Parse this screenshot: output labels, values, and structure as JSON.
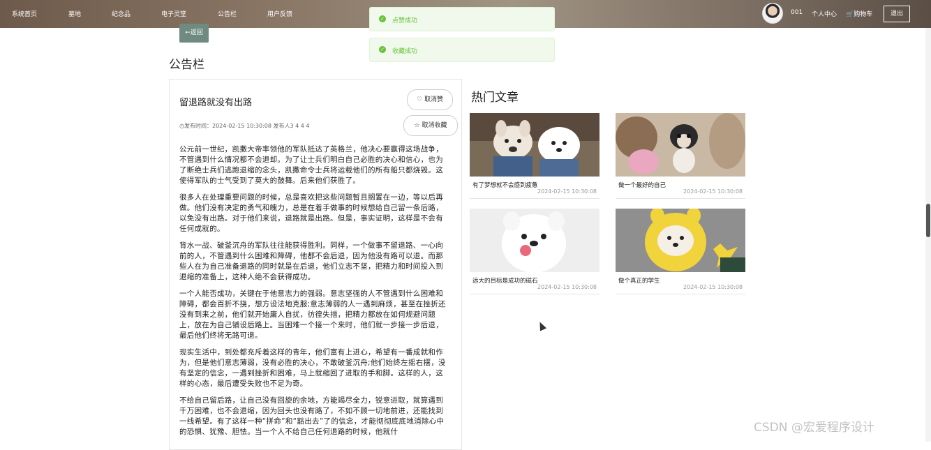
{
  "nav": {
    "items": [
      "系统首页",
      "墓地",
      "纪念品",
      "电子灵堂",
      "公告栏",
      "用户反馈"
    ],
    "user_id": "001",
    "user_center": "个人中心",
    "cart": "购物车",
    "logout": "退出"
  },
  "back_label": "←返回",
  "toasts": [
    "点赞成功",
    "收藏成功"
  ],
  "page_title": "公告栏",
  "article": {
    "title": "留退路就没有出路",
    "unlike_label": "取消赞",
    "unfav_label": "取消收藏",
    "meta": "发布时间：2024-02-15 10:30:08 发布人3 4 4 4",
    "paragraphs": [
      "公元前一世纪，凯撒大帝率领他的军队抵达了英格兰，他决心要赢得这场战争，不管遇到什么情况都不会退却。为了让士兵们明白自己必胜的决心和信心，也为了断绝士兵们逃跑退缩的念头，凯撒命令士兵将运载他们的所有船只都烧毁。这使得军队的士气受到了莫大的鼓舞。后来他们获胜了。",
      "很多人在处理重要问题的时候，总是喜欢把这些问题暂且搁置在一边，等以后再做。他们没有决定的勇气和魄力，总是在着手做事的时候想给自己留一条后路，以免没有出路。对于他们来说，退路就是出路。但是，事实证明，这样是不会有任何成就的。",
      "背水一战、破釜沉舟的军队往往能获得胜利。同样，一个做事不留退路、一心向前的人，不管遇到什么困难和障碍，他都不会后退，因为他没有路可以退。而那些人在为自己准备退路的同时就是在后退，他们立志不坚，把精力和时间投入到退缩的准备上，这种人绝不会获得成功。",
      "一个人能否成功，关键在于他意志力的强弱。意志坚强的人不管遇到什么困难和障碍，都会百折不挠，想方设法地克服;意志薄弱的人一遇到麻烦，甚至在挫折还没有到来之前，他们就开始庸人自扰，彷徨失措，把精力都放在如何规避问题上，放在为自己铺设后路上。当困难一个接一个来时，他们就一步接一步后退，最后他们终将无路可退。",
      "现实生活中，到处都充斥着这样的青年，他们富有上进心，希望有一番成就和作为，但是他们意志薄弱，没有必胜的决心，不敢破釜沉舟;他们始终左摇右摆，没有坚定的信念，一遇到挫折和困难，马上就缩回了进取的手和脚。这样的人，这样的心态，最后遭受失败也不足为奇。",
      "不给自己留后路，让自己没有回旋的余地，方能竭尽全力，锐意进取，就算遇到千万困难，也不会退缩，因为回头也没有路了，不如不顾一切地前进，还能找到一线希望。有了这样一种“拼命”和“豁出去”了的信念，才能彻彻底底地消除心中的恐惧、犹豫、胆怯。当一个人不给自己任何退路的时候，他就什"
    ]
  },
  "hot": {
    "title": "热门文章",
    "items": [
      {
        "caption": "有了梦想就不会感到疲惫",
        "date": "2024-02-15 10:30:08"
      },
      {
        "caption": "做一个最好的自己",
        "date": "2024-02-15 10:30:08"
      },
      {
        "caption": "远大的目标是成功的磁石",
        "date": "2024-02-15 10:30:08"
      },
      {
        "caption": "做个真正的学生",
        "date": "2024-02-15 10:30:08"
      }
    ]
  },
  "watermark": "CSDN @宏爱程序设计",
  "colors": {
    "toast_bg": "#f0f9eb",
    "toast_text": "#67c23a",
    "back_btn": "#6f8a80"
  }
}
